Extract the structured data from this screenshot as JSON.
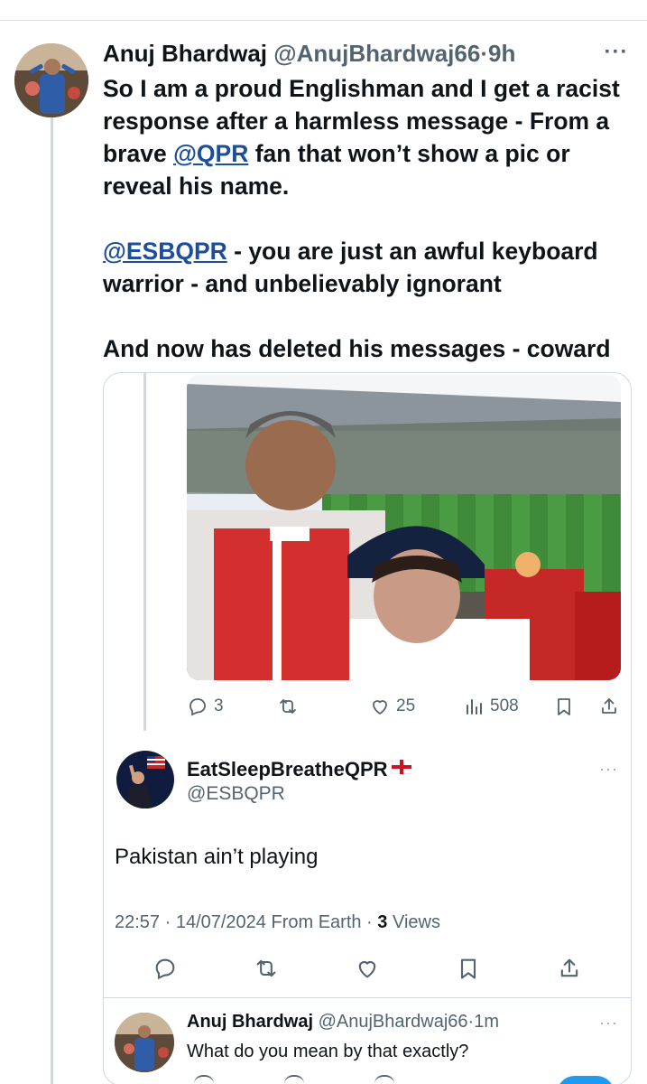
{
  "tweet": {
    "author_name": "Anuj Bhardwaj",
    "author_handle": "@AnujBhardwaj66",
    "separator": "·",
    "time": "9h",
    "more_label": "···",
    "line1_text": "So I am a proud Englishman and I get a racist response after a harmless message - From a brave ",
    "line1_mention": "@QPR",
    "line1_rest": " fan that won’t show a pic or reveal his name.",
    "line2_mention": "@ESBQPR",
    "line2_rest": " - you are just an awful keyboard warrior - and unbelievably ignorant",
    "line3_text": "And now has deleted his messages - coward"
  },
  "quoted_tweet_actions": {
    "replies": "3",
    "retweets": "",
    "likes": "25",
    "views": "508"
  },
  "quoted_reply": {
    "author_name": "EatSleepBreatheQPR",
    "author_handle": "@ESBQPR",
    "more_label": "···",
    "text": "Pakistan ain’t playing",
    "meta_prefix": "22:57 · 14/07/2024 From Earth · ",
    "views_count": "3",
    "views_label": " Views"
  },
  "reply": {
    "author_name": "Anuj Bhardwaj",
    "author_handle": "@AnujBhardwaj66",
    "separator": "·",
    "time": "1m",
    "more_label": "···",
    "text": "What do you mean by that exactly?"
  },
  "icons": {
    "reply": "reply-icon",
    "retweet": "retweet-icon",
    "like": "heart-icon",
    "views": "views-icon",
    "bookmark": "bookmark-icon",
    "share": "share-icon",
    "more": "more-icon",
    "flag": "england-flag-icon"
  },
  "colors": {
    "mention": "#1d4e9b",
    "muted_text": "#536471",
    "divider": "#cfd9de",
    "accent": "#1d9bf0"
  }
}
